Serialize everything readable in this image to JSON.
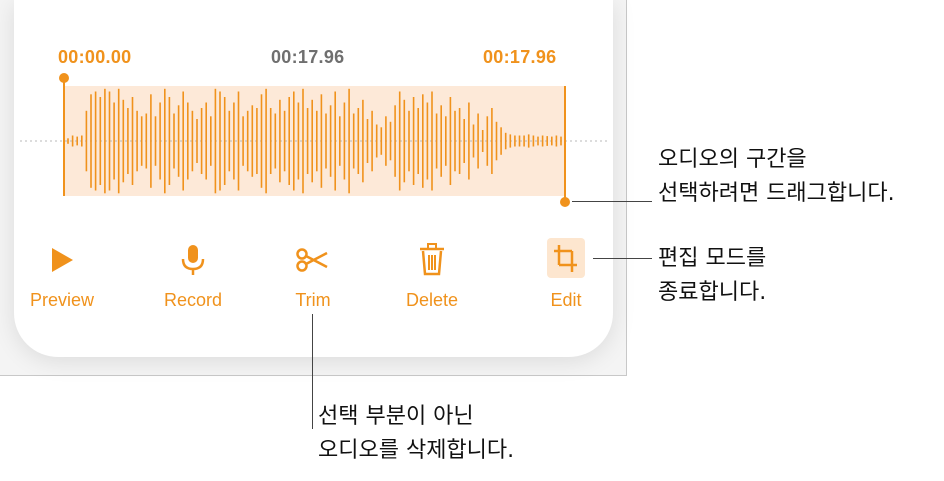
{
  "times": {
    "start": "00:00.00",
    "current": "00:17.96",
    "end": "00:17.96"
  },
  "toolbar": [
    {
      "id": "preview",
      "label": "Preview",
      "icon": "play-icon"
    },
    {
      "id": "record",
      "label": "Record",
      "icon": "microphone-icon"
    },
    {
      "id": "trim",
      "label": "Trim",
      "icon": "scissors-icon"
    },
    {
      "id": "delete",
      "label": "Delete",
      "icon": "trash-icon"
    },
    {
      "id": "edit",
      "label": "Edit",
      "icon": "crop-icon",
      "active": true
    }
  ],
  "callouts": {
    "drag": [
      "오디오의 구간을",
      "선택하려면 드래그합니다."
    ],
    "edit_mode": [
      "편집 모드를",
      "종료합니다."
    ],
    "trim": [
      "선택 부분이 아닌",
      "오디오를 삭제합니다."
    ]
  },
  "colors": {
    "accent": "#f0921c",
    "selection": "#fde9d8",
    "muted_text": "#6f6f6f"
  },
  "waveform": {
    "amplitudes": [
      0.05,
      0.1,
      0.08,
      0.1,
      0.55,
      0.85,
      0.9,
      0.8,
      0.95,
      0.9,
      0.7,
      0.95,
      0.75,
      0.6,
      0.8,
      0.55,
      0.45,
      0.5,
      0.85,
      0.45,
      0.7,
      0.95,
      0.8,
      0.5,
      0.65,
      0.9,
      0.7,
      0.55,
      0.4,
      0.6,
      0.7,
      0.45,
      0.95,
      0.9,
      0.8,
      0.55,
      0.7,
      0.9,
      0.45,
      0.55,
      0.65,
      0.6,
      0.85,
      0.95,
      0.6,
      0.5,
      0.75,
      0.55,
      0.8,
      0.9,
      0.7,
      0.95,
      0.6,
      0.75,
      0.55,
      0.85,
      0.5,
      0.65,
      0.9,
      0.45,
      0.7,
      0.95,
      0.5,
      0.6,
      0.75,
      0.4,
      0.55,
      0.3,
      0.25,
      0.45,
      0.35,
      0.65,
      0.9,
      0.75,
      0.55,
      0.8,
      0.6,
      0.85,
      0.7,
      0.9,
      0.5,
      0.65,
      0.45,
      0.8,
      0.55,
      0.6,
      0.4,
      0.7,
      0.3,
      0.5,
      0.2,
      0.45,
      0.6,
      0.35,
      0.25,
      0.15,
      0.12,
      0.1,
      0.1,
      0.1,
      0.12,
      0.1,
      0.08,
      0.1,
      0.09,
      0.08,
      0.1,
      0.08
    ]
  }
}
